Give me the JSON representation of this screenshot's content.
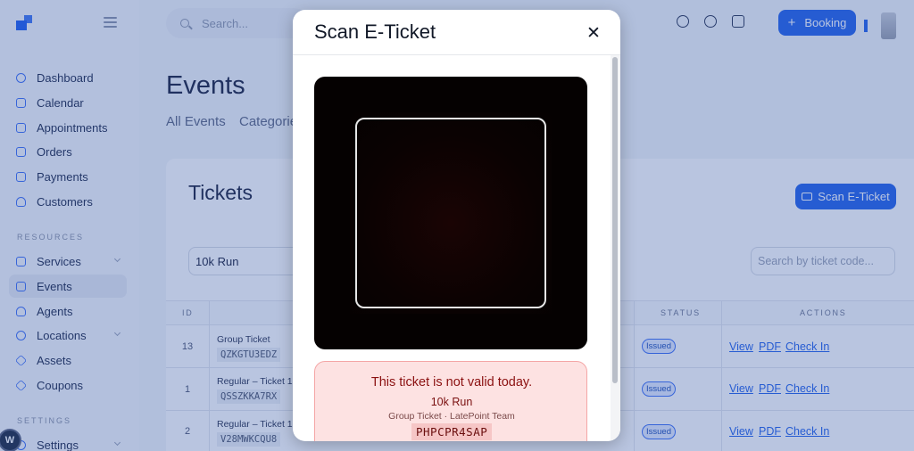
{
  "sidebar": {
    "items": [
      {
        "label": "Dashboard"
      },
      {
        "label": "Calendar"
      },
      {
        "label": "Appointments"
      },
      {
        "label": "Orders"
      },
      {
        "label": "Payments"
      },
      {
        "label": "Customers"
      }
    ],
    "resources_label": "RESOURCES",
    "resources": [
      {
        "label": "Services"
      },
      {
        "label": "Events"
      },
      {
        "label": "Agents"
      },
      {
        "label": "Locations"
      },
      {
        "label": "Assets"
      },
      {
        "label": "Coupons"
      }
    ],
    "settings_label": "SETTINGS",
    "settings_item": "Settings",
    "wp_badge": "W"
  },
  "topbar": {
    "search_placeholder": "Search...",
    "booking_label": "Booking",
    "booking_plus": "+"
  },
  "main": {
    "title": "Events",
    "tabs": [
      "All Events",
      "Categories"
    ],
    "tickets_title": "Tickets",
    "scan_button": "Scan E-Ticket",
    "filter_value": "10k Run",
    "ticket_search_placeholder": "Search by ticket code..."
  },
  "table": {
    "headers": {
      "id": "ID",
      "status": "STATUS",
      "actions": "ACTIONS"
    },
    "rows": [
      {
        "id": "13",
        "name": "Group Ticket",
        "code": "QZKGTU3EDZ",
        "status": "Issued"
      },
      {
        "id": "1",
        "name": "Regular – Ticket 1",
        "code": "QSSZKKA7RX",
        "status": "Issued"
      },
      {
        "id": "2",
        "name": "Regular – Ticket 1",
        "code": "V28MWKCQU8",
        "status": "Issued"
      }
    ],
    "actions": {
      "view": "View",
      "pdf": "PDF",
      "checkin": "Check In"
    }
  },
  "modal": {
    "title": "Scan E-Ticket",
    "close": "✕",
    "result": {
      "message": "This ticket is not valid today.",
      "event": "10k Run",
      "subtitle": "Group Ticket · LatePoint Team",
      "code": "PHPCPR4SAP"
    }
  },
  "colors": {
    "accent": "#2563eb",
    "error_bg": "#fde2e2",
    "error_text": "#8b1111",
    "overlay": "rgba(44,78,160,0.33)"
  }
}
